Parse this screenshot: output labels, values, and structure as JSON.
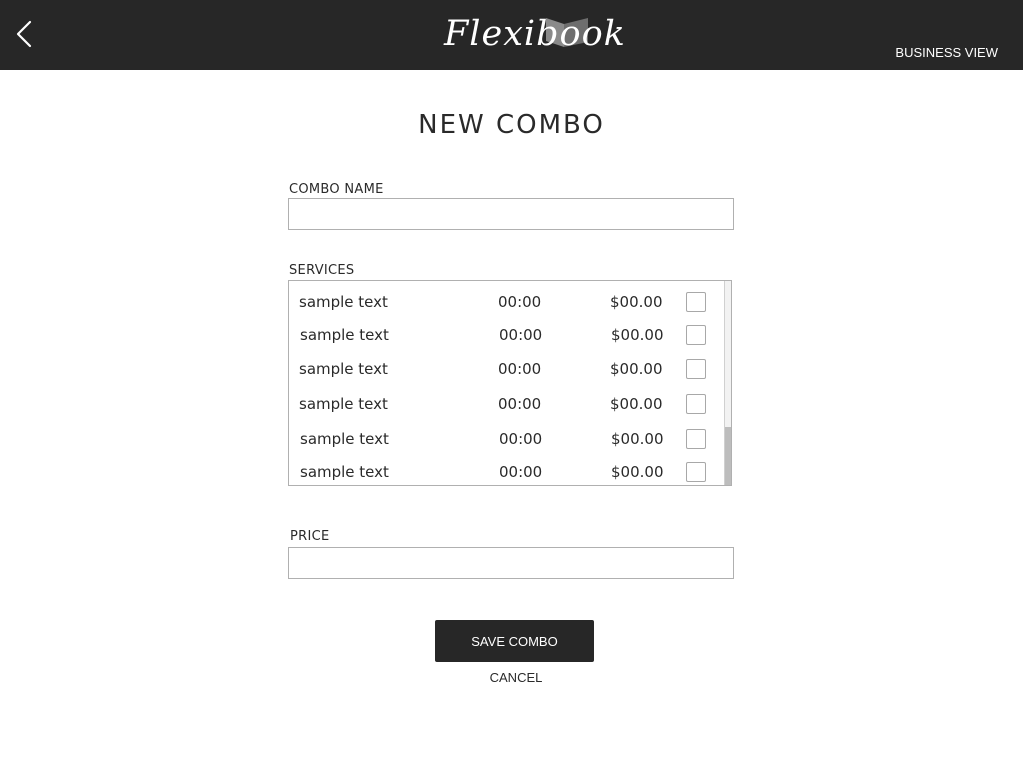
{
  "header": {
    "logo_text": "Flexibook",
    "business_view_label": "BUSINESS VIEW",
    "back_icon": "chevron-left-icon",
    "logo_icon": "open-book-icon",
    "background_color": "#272727"
  },
  "page": {
    "title": "NEW COMBO"
  },
  "form": {
    "combo_name_label": "COMBO NAME",
    "combo_name_value": "",
    "services_label": "SERVICES",
    "services": [
      {
        "name": "sample text",
        "duration": "00:00",
        "price": "$00.00",
        "checked": false
      },
      {
        "name": "sample text",
        "duration": "00:00",
        "price": "$00.00",
        "checked": false
      },
      {
        "name": "sample text",
        "duration": "00:00",
        "price": "$00.00",
        "checked": false
      },
      {
        "name": "sample text",
        "duration": "00:00",
        "price": "$00.00",
        "checked": false
      },
      {
        "name": "sample text",
        "duration": "00:00",
        "price": "$00.00",
        "checked": false
      },
      {
        "name": "sample text",
        "duration": "00:00",
        "price": "$00.00",
        "checked": false
      }
    ],
    "price_label": "PRICE",
    "price_value": ""
  },
  "actions": {
    "save_label": "SAVE COMBO",
    "cancel_label": "CANCEL",
    "save_color": "#272727"
  }
}
